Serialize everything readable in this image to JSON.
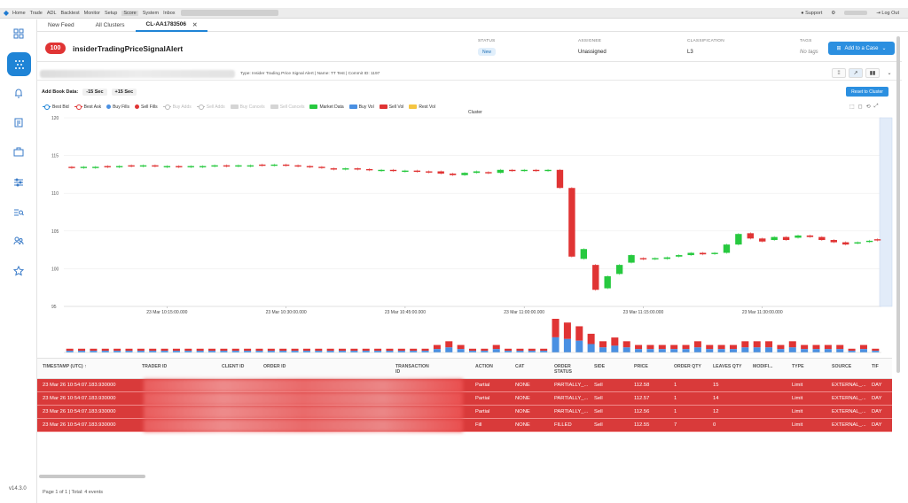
{
  "topbar": {
    "nav": [
      "Home",
      "Trade",
      "ADL",
      "Backtest",
      "Monitor",
      "Setup",
      "Score",
      "System",
      "Inbox"
    ],
    "active_nav": "Score",
    "support": "Support",
    "logout": "Log Out"
  },
  "sidebar": {
    "icons": [
      "dashboard-icon",
      "cluster-icon",
      "bell-icon",
      "clipboard-icon",
      "briefcase-icon",
      "sliders-icon",
      "search-list-icon",
      "users-icon",
      "star-icon"
    ],
    "version": "v14.3.0"
  },
  "tabs": [
    {
      "label": "New Feed"
    },
    {
      "label": "All Clusters"
    },
    {
      "label": "CL-AA1783506",
      "closable": true
    }
  ],
  "header": {
    "score": "100",
    "title": "insiderTradingPriceSignalAlert",
    "status_label": "STATUS",
    "status_value": "New",
    "assignee_label": "ASSIGNEE",
    "assignee_value": "Unassigned",
    "classification_label": "CLASSIFICATION",
    "classification_value": "L3",
    "tags_label": "TAGS",
    "tags_value": "No tags",
    "add_case_label": "Add to a Case",
    "colors": {
      "score_badge": "#e03434",
      "accent": "#2b8fe0"
    }
  },
  "infobar": {
    "description": "Type: Insider Trading Price Signal Alert | Name: TT Test | Commit ID: 1197"
  },
  "bookbar": {
    "label": "Add Book Data:",
    "minus": "-15 Sec",
    "plus": "+15 Sec",
    "reset": "Reset to Cluster"
  },
  "legend": [
    {
      "label": "Best Bid",
      "kind": "dotline",
      "color": "#1f84d6",
      "active": true
    },
    {
      "label": "Best Ask",
      "kind": "dotline",
      "color": "#e03434",
      "active": true
    },
    {
      "label": "Buy Fills",
      "kind": "dot",
      "color": "#4a90e2",
      "active": true
    },
    {
      "label": "Sell Fills",
      "kind": "dot",
      "color": "#e03434",
      "active": true
    },
    {
      "label": "Buy Adds",
      "kind": "dotline",
      "color": "#bbbbbb",
      "active": false
    },
    {
      "label": "Sell Adds",
      "kind": "dotline",
      "color": "#bbbbbb",
      "active": false
    },
    {
      "label": "Buy Cancels",
      "kind": "box",
      "color": "#d5d5d5",
      "active": false
    },
    {
      "label": "Sell Cancels",
      "kind": "box",
      "color": "#d5d5d5",
      "active": false
    },
    {
      "label": "Market Data",
      "kind": "box",
      "color": "#27c93f",
      "active": true
    },
    {
      "label": "Buy Vol",
      "kind": "box",
      "color": "#4a90e2",
      "active": true
    },
    {
      "label": "Sell Vol",
      "kind": "box",
      "color": "#e03434",
      "active": true
    },
    {
      "label": "Rest Vol",
      "kind": "box",
      "color": "#f5c542",
      "active": true
    }
  ],
  "chart_data": {
    "type": "candlestick",
    "title": "Cluster",
    "ylim": [
      95,
      120
    ],
    "yticks": [
      95,
      100,
      105,
      110,
      115,
      120
    ],
    "xtick_labels": [
      "23 Mar 10:15:00.000",
      "23 Mar 10:30:00.000",
      "23 Mar 10:45:00.000",
      "23 Mar 11:00:00.000",
      "23 Mar 11:15:00.000",
      "23 Mar 11:30:00.000"
    ],
    "xtick_minutes": [
      15,
      30,
      45,
      60,
      75,
      90
    ],
    "xlim_minutes": [
      2,
      105
    ],
    "colors": {
      "up": "#27c93f",
      "down": "#e03434"
    },
    "candles": [
      {
        "t": 3,
        "o": 113.5,
        "c": 113.4
      },
      {
        "t": 4.5,
        "o": 113.4,
        "c": 113.5
      },
      {
        "t": 6,
        "o": 113.5,
        "c": 113.5
      },
      {
        "t": 7.5,
        "o": 113.6,
        "c": 113.5
      },
      {
        "t": 9,
        "o": 113.5,
        "c": 113.6
      },
      {
        "t": 10.5,
        "o": 113.7,
        "c": 113.6
      },
      {
        "t": 12,
        "o": 113.6,
        "c": 113.7
      },
      {
        "t": 13.5,
        "o": 113.7,
        "c": 113.6
      },
      {
        "t": 15,
        "o": 113.6,
        "c": 113.6
      },
      {
        "t": 16.5,
        "o": 113.6,
        "c": 113.5
      },
      {
        "t": 18,
        "o": 113.5,
        "c": 113.6
      },
      {
        "t": 19.5,
        "o": 113.6,
        "c": 113.6
      },
      {
        "t": 21,
        "o": 113.6,
        "c": 113.7
      },
      {
        "t": 22.5,
        "o": 113.7,
        "c": 113.6
      },
      {
        "t": 24,
        "o": 113.6,
        "c": 113.7
      },
      {
        "t": 25.5,
        "o": 113.7,
        "c": 113.7
      },
      {
        "t": 27,
        "o": 113.8,
        "c": 113.7
      },
      {
        "t": 28.5,
        "o": 113.7,
        "c": 113.8
      },
      {
        "t": 30,
        "o": 113.8,
        "c": 113.7
      },
      {
        "t": 31.5,
        "o": 113.7,
        "c": 113.6
      },
      {
        "t": 33,
        "o": 113.6,
        "c": 113.5
      },
      {
        "t": 34.5,
        "o": 113.5,
        "c": 113.4
      },
      {
        "t": 36,
        "o": 113.3,
        "c": 113.2
      },
      {
        "t": 37.5,
        "o": 113.3,
        "c": 113.3
      },
      {
        "t": 39,
        "o": 113.3,
        "c": 113.2
      },
      {
        "t": 40.5,
        "o": 113.2,
        "c": 113.1
      },
      {
        "t": 42,
        "o": 113.1,
        "c": 113.1
      },
      {
        "t": 43.5,
        "o": 113.1,
        "c": 113.0
      },
      {
        "t": 45,
        "o": 113.0,
        "c": 113.0
      },
      {
        "t": 46.5,
        "o": 113.0,
        "c": 112.9
      },
      {
        "t": 48,
        "o": 112.9,
        "c": 112.8
      },
      {
        "t": 49.5,
        "o": 112.9,
        "c": 112.6
      },
      {
        "t": 51,
        "o": 112.6,
        "c": 112.4
      },
      {
        "t": 52.5,
        "o": 112.4,
        "c": 112.7
      },
      {
        "t": 54,
        "o": 112.7,
        "c": 112.9
      },
      {
        "t": 55.5,
        "o": 112.8,
        "c": 112.7
      },
      {
        "t": 57,
        "o": 112.7,
        "c": 113.1
      },
      {
        "t": 58.5,
        "o": 113.1,
        "c": 113.0
      },
      {
        "t": 60,
        "o": 113.0,
        "c": 113.1
      },
      {
        "t": 61.5,
        "o": 113.1,
        "c": 113.0
      },
      {
        "t": 63,
        "o": 113.0,
        "c": 113.1
      },
      {
        "t": 64.5,
        "o": 113.1,
        "c": 110.7
      },
      {
        "t": 66,
        "o": 110.7,
        "c": 101.6
      },
      {
        "t": 67.5,
        "o": 101.3,
        "c": 102.6
      },
      {
        "t": 69,
        "o": 100.5,
        "c": 97.2
      },
      {
        "t": 70.5,
        "o": 97.4,
        "c": 99.0
      },
      {
        "t": 72,
        "o": 99.3,
        "c": 100.5
      },
      {
        "t": 73.5,
        "o": 100.8,
        "c": 101.8
      },
      {
        "t": 75,
        "o": 101.4,
        "c": 101.3
      },
      {
        "t": 76.5,
        "o": 101.3,
        "c": 101.4
      },
      {
        "t": 78,
        "o": 101.3,
        "c": 101.5
      },
      {
        "t": 79.5,
        "o": 101.6,
        "c": 101.8
      },
      {
        "t": 81,
        "o": 101.8,
        "c": 102.1
      },
      {
        "t": 82.5,
        "o": 102.1,
        "c": 101.9
      },
      {
        "t": 84,
        "o": 102.0,
        "c": 102.1
      },
      {
        "t": 85.5,
        "o": 102.1,
        "c": 103.2
      },
      {
        "t": 87,
        "o": 103.2,
        "c": 104.6
      },
      {
        "t": 88.5,
        "o": 104.7,
        "c": 104.0
      },
      {
        "t": 90,
        "o": 104.0,
        "c": 103.6
      },
      {
        "t": 91.5,
        "o": 103.8,
        "c": 104.2
      },
      {
        "t": 93,
        "o": 104.2,
        "c": 103.8
      },
      {
        "t": 94.5,
        "o": 104.1,
        "c": 104.4
      },
      {
        "t": 96,
        "o": 104.4,
        "c": 104.2
      },
      {
        "t": 97.5,
        "o": 104.2,
        "c": 103.8
      },
      {
        "t": 99,
        "o": 103.8,
        "c": 103.5
      },
      {
        "t": 100.5,
        "o": 103.5,
        "c": 103.2
      },
      {
        "t": 102,
        "o": 103.4,
        "c": 103.5
      },
      {
        "t": 103.5,
        "o": 103.6,
        "c": 103.7
      },
      {
        "t": 104.5,
        "o": 103.9,
        "c": 103.8
      }
    ],
    "volume": [
      1,
      1,
      1,
      1,
      1,
      1,
      1,
      1,
      1,
      1,
      1,
      1,
      1,
      1,
      1,
      1,
      1,
      1,
      1,
      1,
      1,
      1,
      1,
      1,
      1,
      1,
      1,
      1,
      1,
      1,
      1,
      2,
      3,
      2,
      1,
      1,
      2,
      1,
      1,
      1,
      1,
      9,
      8,
      7,
      5,
      3,
      4,
      3,
      2,
      2,
      2,
      2,
      2,
      3,
      2,
      2,
      2,
      3,
      3,
      3,
      2,
      3,
      2,
      2,
      2,
      2,
      1,
      2,
      1
    ]
  },
  "table": {
    "headers": [
      "TIMESTAMP (UTC)",
      "TRADER ID",
      "CLIENT ID",
      "ORDER ID",
      "TRANSACTION ID",
      "ACTION",
      "CAT",
      "ORDER STATUS",
      "SIDE",
      "PRICE",
      "ORDER QTY",
      "LEAVES QTY",
      "MODIFI...",
      "TYPE",
      "SOURCE",
      "TIF"
    ],
    "rows": [
      {
        "ts": "23 Mar 26 10:54:07.183.930000",
        "action": "Partial",
        "cat": "NONE",
        "status": "PARTIALLY_...",
        "side": "Sell",
        "price": "112.58",
        "qty": "1",
        "leaves": "15",
        "type": "Limit",
        "source": "EXTERNAL_...",
        "tif": "DAY"
      },
      {
        "ts": "23 Mar 26 10:54:07.183.930000",
        "action": "Partial",
        "cat": "NONE",
        "status": "PARTIALLY_...",
        "side": "Sell",
        "price": "112.57",
        "qty": "1",
        "leaves": "14",
        "type": "Limit",
        "source": "EXTERNAL_...",
        "tif": "DAY"
      },
      {
        "ts": "23 Mar 26 10:54:07.183.930000",
        "action": "Partial",
        "cat": "NONE",
        "status": "PARTIALLY_...",
        "side": "Sell",
        "price": "112.56",
        "qty": "1",
        "leaves": "12",
        "type": "Limit",
        "source": "EXTERNAL_...",
        "tif": "DAY"
      },
      {
        "ts": "23 Mar 26 10:54:07.183.930000",
        "action": "Fill",
        "cat": "NONE",
        "status": "FILLED",
        "side": "Sell",
        "price": "112.55",
        "qty": "7",
        "leaves": "0",
        "type": "Limit",
        "source": "EXTERNAL_...",
        "tif": "DAY"
      }
    ],
    "row_color": "#d93a3a"
  },
  "pager": "Page 1 of 1 | Total: 4 events"
}
